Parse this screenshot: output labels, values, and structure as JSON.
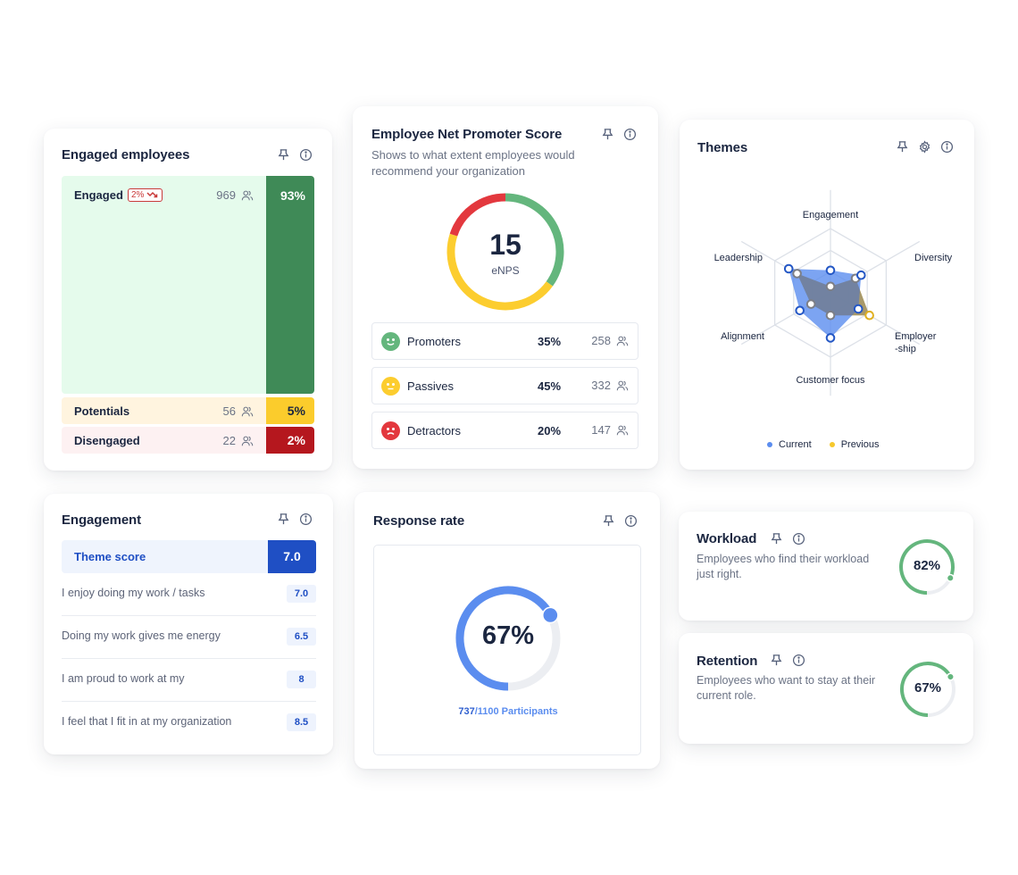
{
  "engaged_employees": {
    "title": "Engaged employees",
    "rows": [
      {
        "label": "Engaged",
        "count": "969",
        "percent": "93%",
        "trend": "2%",
        "trend_direction": "down"
      },
      {
        "label": "Potentials",
        "count": "56",
        "percent": "5%"
      },
      {
        "label": "Disengaged",
        "count": "22",
        "percent": "2%"
      }
    ],
    "colors": {
      "engaged": "#3f8a57",
      "engaged_bg": "#e5fbec",
      "potentials": "#fbcc2c",
      "potentials_bg": "#fff4df",
      "disengaged": "#b5171e",
      "disengaged_bg": "#fdf1f2"
    }
  },
  "enps": {
    "title": "Employee Net Promoter Score",
    "subtitle": "Shows to what extent employees would recommend your organization",
    "score": "15",
    "score_label": "eNPS",
    "segments": [
      {
        "label": "Promoters",
        "percent": "35%",
        "value": 35,
        "count": "258",
        "color": "#64b67d",
        "face": "smile"
      },
      {
        "label": "Passives",
        "percent": "45%",
        "value": 45,
        "count": "332",
        "color": "#fccd2f",
        "face": "neutral"
      },
      {
        "label": "Detractors",
        "percent": "20%",
        "value": 20,
        "count": "147",
        "color": "#e3383e",
        "face": "sad"
      }
    ]
  },
  "themes": {
    "title": "Themes",
    "axes": [
      "Engagement",
      "Diversity",
      "Employer-ship",
      "Customer focus",
      "Alignment",
      "Leadership"
    ],
    "axis_display": [
      "Engagement",
      "Diversity",
      "Employer",
      "-ship",
      "Customer focus",
      "Alignment",
      "Leadership"
    ],
    "series": [
      {
        "name": "Current",
        "color": "#5b8def",
        "values": [
          0.35,
          0.55,
          0.5,
          0.7,
          0.55,
          0.75
        ]
      },
      {
        "name": "Previous",
        "color": "#f0c33a",
        "values": [
          0.1,
          0.45,
          0.7,
          0.35,
          0.35,
          0.6
        ]
      }
    ],
    "legend": {
      "current": "Current",
      "previous": "Previous"
    }
  },
  "engagement": {
    "title": "Engagement",
    "theme_score_label": "Theme score",
    "theme_score": "7.0",
    "items": [
      {
        "text": "I enjoy doing my work / tasks",
        "score": "7.0"
      },
      {
        "text": "Doing my work gives me energy",
        "score": "6.5"
      },
      {
        "text": "I am proud to work at my",
        "score": "8"
      },
      {
        "text": "I feel that I fit in at my organization",
        "score": "8.5"
      }
    ]
  },
  "response_rate": {
    "title": "Response rate",
    "percent_label": "67%",
    "value": 0.67,
    "responded": "737",
    "total": "/1100 Participants",
    "color": "#5b8def"
  },
  "workload": {
    "title": "Workload",
    "description": "Employees who find their workload just right.",
    "percent_label": "82%",
    "value": 0.82,
    "color": "#64b67d"
  },
  "retention": {
    "title": "Retention",
    "description": "Employees who want to stay at their current role.",
    "percent_label": "67%",
    "value": 0.67,
    "color": "#64b67d"
  }
}
